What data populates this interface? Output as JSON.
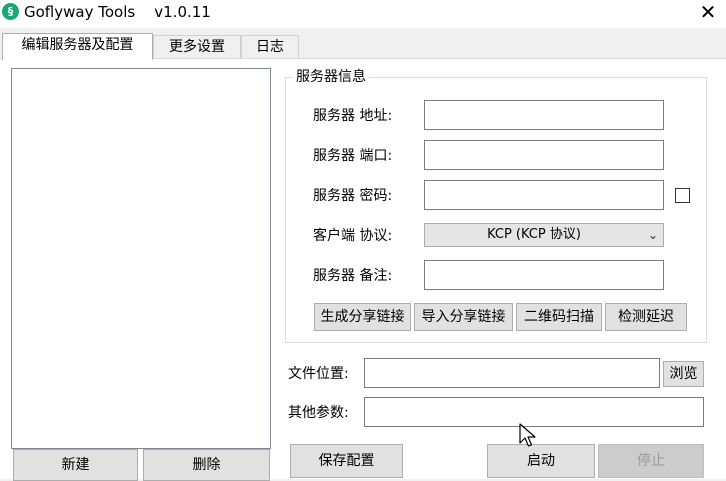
{
  "window": {
    "title": "Goflyway Tools    v1.0.11",
    "icon": "app-icon",
    "close_glyph": "✕"
  },
  "tabs": [
    {
      "label": "编辑服务器及配置",
      "active": true
    },
    {
      "label": "更多设置",
      "active": false
    },
    {
      "label": "日志",
      "active": false
    }
  ],
  "server_list": {
    "items": [],
    "new_button": "新建",
    "delete_button": "删除"
  },
  "server_info": {
    "group_title": "服务器信息",
    "address_label": "服务器 地址:",
    "address_value": "",
    "port_label": "服务器 端口:",
    "port_value": "",
    "password_label": "服务器 密码:",
    "password_value": "",
    "password_show_checked": false,
    "protocol_label": "客户端 协议:",
    "protocol_value": "KCP  (KCP 协议)",
    "note_label": "服务器 备注:",
    "note_value": "",
    "buttons": {
      "generate_link": "生成分享链接",
      "import_link": "导入分享链接",
      "qr_scan": "二维码扫描",
      "check_latency": "检测延迟"
    }
  },
  "file_location": {
    "label": "文件位置:",
    "value": "",
    "browse_button": "浏览"
  },
  "other_params": {
    "label": "其他参数:",
    "value": ""
  },
  "actions": {
    "save_config": "保存配置",
    "start": "启动",
    "stop": "停止"
  }
}
